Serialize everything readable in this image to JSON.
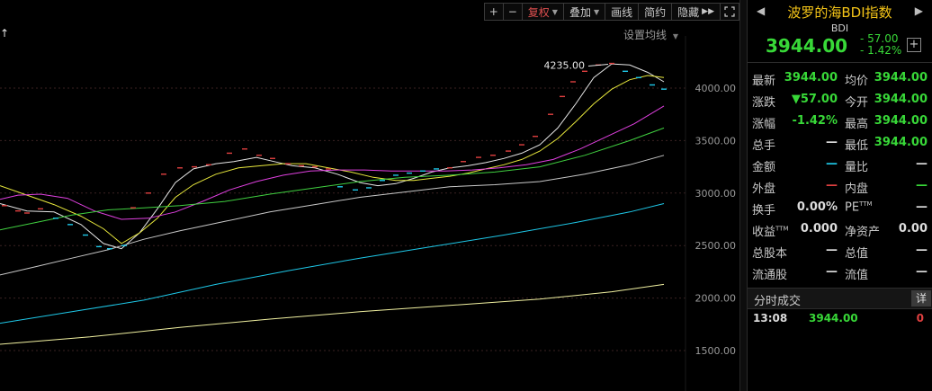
{
  "toolbar": {
    "zoom_in": "+",
    "zoom_out": "−",
    "adjust": "复权",
    "overlay": "叠加",
    "draw": "画线",
    "brief": "简约",
    "hide": "隐藏",
    "expand_icon": "double-chevron-right-icon",
    "fullscreen_icon": "fullscreen-icon"
  },
  "chart_header": {
    "arrow": "↑",
    "ma_settings": "设置均线"
  },
  "chart_data": {
    "type": "line",
    "y_ticks": [
      "4000.00",
      "3500.00",
      "3000.00",
      "2500.00",
      "2000.00",
      "1500.00"
    ],
    "ylim": [
      1400,
      4300
    ],
    "annotation": "4235.00",
    "colors": {
      "up": "#e04040",
      "down": "#1ec8e8",
      "grid": "#3a2222",
      "axis_text": "#9a9a9a"
    },
    "candles_up": [
      [
        5,
        2880
      ],
      [
        20,
        2830
      ],
      [
        30,
        2810
      ],
      [
        45,
        2850
      ],
      [
        148,
        2860
      ],
      [
        165,
        3000
      ],
      [
        182,
        3180
      ],
      [
        200,
        3240
      ],
      [
        216,
        3250
      ],
      [
        232,
        3270
      ],
      [
        255,
        3380
      ],
      [
        272,
        3420
      ],
      [
        288,
        3360
      ],
      [
        303,
        3330
      ],
      [
        320,
        3280
      ],
      [
        335,
        3260
      ],
      [
        350,
        3250
      ],
      [
        365,
        3230
      ],
      [
        500,
        3240
      ],
      [
        515,
        3300
      ],
      [
        532,
        3340
      ],
      [
        548,
        3360
      ],
      [
        565,
        3400
      ],
      [
        580,
        3460
      ],
      [
        595,
        3540
      ],
      [
        612,
        3750
      ],
      [
        625,
        3920
      ],
      [
        637,
        4060
      ],
      [
        650,
        4160
      ],
      [
        665,
        4220
      ],
      [
        680,
        4235
      ]
    ],
    "candles_down": [
      [
        62,
        2760
      ],
      [
        78,
        2700
      ],
      [
        95,
        2600
      ],
      [
        110,
        2490
      ],
      [
        122,
        2470
      ],
      [
        138,
        2500
      ],
      [
        378,
        3060
      ],
      [
        395,
        3030
      ],
      [
        410,
        3050
      ],
      [
        425,
        3120
      ],
      [
        440,
        3170
      ],
      [
        455,
        3190
      ],
      [
        470,
        3210
      ],
      [
        485,
        3230
      ],
      [
        695,
        4160
      ],
      [
        710,
        4100
      ],
      [
        725,
        4030
      ],
      [
        738,
        3990
      ]
    ],
    "series": [
      {
        "color": "#e6e6e6",
        "values": [
          [
            0,
            2900
          ],
          [
            30,
            2830
          ],
          [
            60,
            2820
          ],
          [
            90,
            2700
          ],
          [
            115,
            2520
          ],
          [
            135,
            2470
          ],
          [
            155,
            2620
          ],
          [
            175,
            2850
          ],
          [
            195,
            3100
          ],
          [
            215,
            3230
          ],
          [
            240,
            3280
          ],
          [
            260,
            3300
          ],
          [
            285,
            3340
          ],
          [
            305,
            3300
          ],
          [
            325,
            3260
          ],
          [
            350,
            3240
          ],
          [
            375,
            3180
          ],
          [
            400,
            3100
          ],
          [
            420,
            3070
          ],
          [
            440,
            3090
          ],
          [
            460,
            3140
          ],
          [
            480,
            3200
          ],
          [
            500,
            3240
          ],
          [
            520,
            3260
          ],
          [
            540,
            3290
          ],
          [
            560,
            3330
          ],
          [
            580,
            3380
          ],
          [
            600,
            3460
          ],
          [
            620,
            3620
          ],
          [
            640,
            3850
          ],
          [
            660,
            4100
          ],
          [
            680,
            4230
          ],
          [
            700,
            4220
          ],
          [
            720,
            4150
          ],
          [
            738,
            4060
          ]
        ]
      },
      {
        "color": "#e8e83c",
        "values": [
          [
            0,
            3070
          ],
          [
            30,
            2980
          ],
          [
            60,
            2890
          ],
          [
            90,
            2780
          ],
          [
            115,
            2660
          ],
          [
            135,
            2520
          ],
          [
            155,
            2620
          ],
          [
            175,
            2760
          ],
          [
            195,
            2960
          ],
          [
            215,
            3080
          ],
          [
            240,
            3180
          ],
          [
            265,
            3240
          ],
          [
            290,
            3260
          ],
          [
            315,
            3280
          ],
          [
            340,
            3280
          ],
          [
            365,
            3240
          ],
          [
            390,
            3200
          ],
          [
            415,
            3150
          ],
          [
            440,
            3120
          ],
          [
            460,
            3120
          ],
          [
            480,
            3140
          ],
          [
            500,
            3160
          ],
          [
            520,
            3190
          ],
          [
            540,
            3230
          ],
          [
            560,
            3270
          ],
          [
            580,
            3320
          ],
          [
            600,
            3400
          ],
          [
            620,
            3520
          ],
          [
            640,
            3680
          ],
          [
            660,
            3850
          ],
          [
            680,
            3990
          ],
          [
            700,
            4080
          ],
          [
            720,
            4120
          ],
          [
            738,
            4100
          ]
        ]
      },
      {
        "color": "#e040e0",
        "values": [
          [
            0,
            2940
          ],
          [
            20,
            2980
          ],
          [
            45,
            2990
          ],
          [
            75,
            2950
          ],
          [
            105,
            2830
          ],
          [
            135,
            2750
          ],
          [
            165,
            2760
          ],
          [
            195,
            2820
          ],
          [
            225,
            2920
          ],
          [
            255,
            3030
          ],
          [
            285,
            3110
          ],
          [
            315,
            3170
          ],
          [
            345,
            3210
          ],
          [
            375,
            3220
          ],
          [
            405,
            3220
          ],
          [
            435,
            3210
          ],
          [
            465,
            3210
          ],
          [
            495,
            3210
          ],
          [
            525,
            3220
          ],
          [
            555,
            3240
          ],
          [
            585,
            3270
          ],
          [
            615,
            3320
          ],
          [
            645,
            3420
          ],
          [
            675,
            3540
          ],
          [
            705,
            3660
          ],
          [
            738,
            3830
          ]
        ]
      },
      {
        "color": "#40d040",
        "values": [
          [
            0,
            2650
          ],
          [
            40,
            2720
          ],
          [
            80,
            2790
          ],
          [
            120,
            2840
          ],
          [
            160,
            2860
          ],
          [
            200,
            2880
          ],
          [
            250,
            2920
          ],
          [
            300,
            2990
          ],
          [
            350,
            3050
          ],
          [
            400,
            3110
          ],
          [
            450,
            3150
          ],
          [
            500,
            3170
          ],
          [
            550,
            3200
          ],
          [
            600,
            3250
          ],
          [
            650,
            3360
          ],
          [
            700,
            3500
          ],
          [
            738,
            3620
          ]
        ]
      },
      {
        "color": "#c8c8c8",
        "values": [
          [
            0,
            2220
          ],
          [
            40,
            2300
          ],
          [
            80,
            2380
          ],
          [
            120,
            2460
          ],
          [
            160,
            2560
          ],
          [
            200,
            2640
          ],
          [
            250,
            2730
          ],
          [
            300,
            2820
          ],
          [
            350,
            2890
          ],
          [
            400,
            2960
          ],
          [
            450,
            3010
          ],
          [
            500,
            3060
          ],
          [
            550,
            3080
          ],
          [
            600,
            3110
          ],
          [
            650,
            3180
          ],
          [
            700,
            3270
          ],
          [
            738,
            3360
          ]
        ]
      },
      {
        "color": "#1ec8e8",
        "values": [
          [
            0,
            1760
          ],
          [
            80,
            1870
          ],
          [
            160,
            1980
          ],
          [
            240,
            2130
          ],
          [
            320,
            2260
          ],
          [
            400,
            2380
          ],
          [
            480,
            2490
          ],
          [
            560,
            2600
          ],
          [
            640,
            2720
          ],
          [
            700,
            2820
          ],
          [
            738,
            2900
          ]
        ]
      },
      {
        "color": "#f0f0a0",
        "values": [
          [
            0,
            1560
          ],
          [
            100,
            1630
          ],
          [
            200,
            1720
          ],
          [
            300,
            1800
          ],
          [
            400,
            1870
          ],
          [
            500,
            1930
          ],
          [
            600,
            1990
          ],
          [
            680,
            2060
          ],
          [
            738,
            2130
          ]
        ]
      }
    ]
  },
  "panel": {
    "prev": "◀",
    "next": "▶",
    "title": "波罗的海BDI指数",
    "code": "BDI",
    "price": "3944.00",
    "change": "- 57.00",
    "change_pct": "- 1.42%",
    "add_icon": "+",
    "stats": [
      {
        "l1": "最新",
        "v1": "3944.00",
        "c1": "green",
        "l2": "均价",
        "v2": "3944.00",
        "c2": "green"
      },
      {
        "l1": "涨跌",
        "v1": "▼57.00",
        "c1": "green",
        "l2": "今开",
        "v2": "3944.00",
        "c2": "green"
      },
      {
        "l1": "涨幅",
        "v1": "-1.42%",
        "c1": "green",
        "l2": "最高",
        "v2": "3944.00",
        "c2": "green"
      },
      {
        "l1": "总手",
        "v1": "—",
        "c1": "white",
        "l2": "最低",
        "v2": "3944.00",
        "c2": "green"
      },
      {
        "l1": "金额",
        "v1": "—",
        "c1": "cyan",
        "l2": "量比",
        "v2": "—",
        "c2": "white"
      },
      {
        "l1": "外盘",
        "v1": "—",
        "c1": "red",
        "l2": "内盘",
        "v2": "—",
        "c2": "green"
      },
      {
        "l1": "换手",
        "v1": "0.00%",
        "c1": "white",
        "l2": "PE",
        "l2sup": "TTM",
        "v2": "—",
        "c2": "white"
      },
      {
        "l1": "收益",
        "l1sup": "TTM",
        "v1": "0.000",
        "c1": "white",
        "l2": "净资产",
        "v2": "0.00",
        "c2": "white"
      },
      {
        "l1": "总股本",
        "v1": "—",
        "c1": "white",
        "l2": "总值",
        "v2": "—",
        "c2": "white"
      },
      {
        "l1": "流通股",
        "v1": "—",
        "c1": "white",
        "l2": "流值",
        "v2": "—",
        "c2": "white"
      }
    ],
    "ticks_title": "分时成交",
    "ticks_detail": "详",
    "tick": {
      "time": "13:08",
      "price": "3944.00",
      "vol": "0"
    }
  }
}
